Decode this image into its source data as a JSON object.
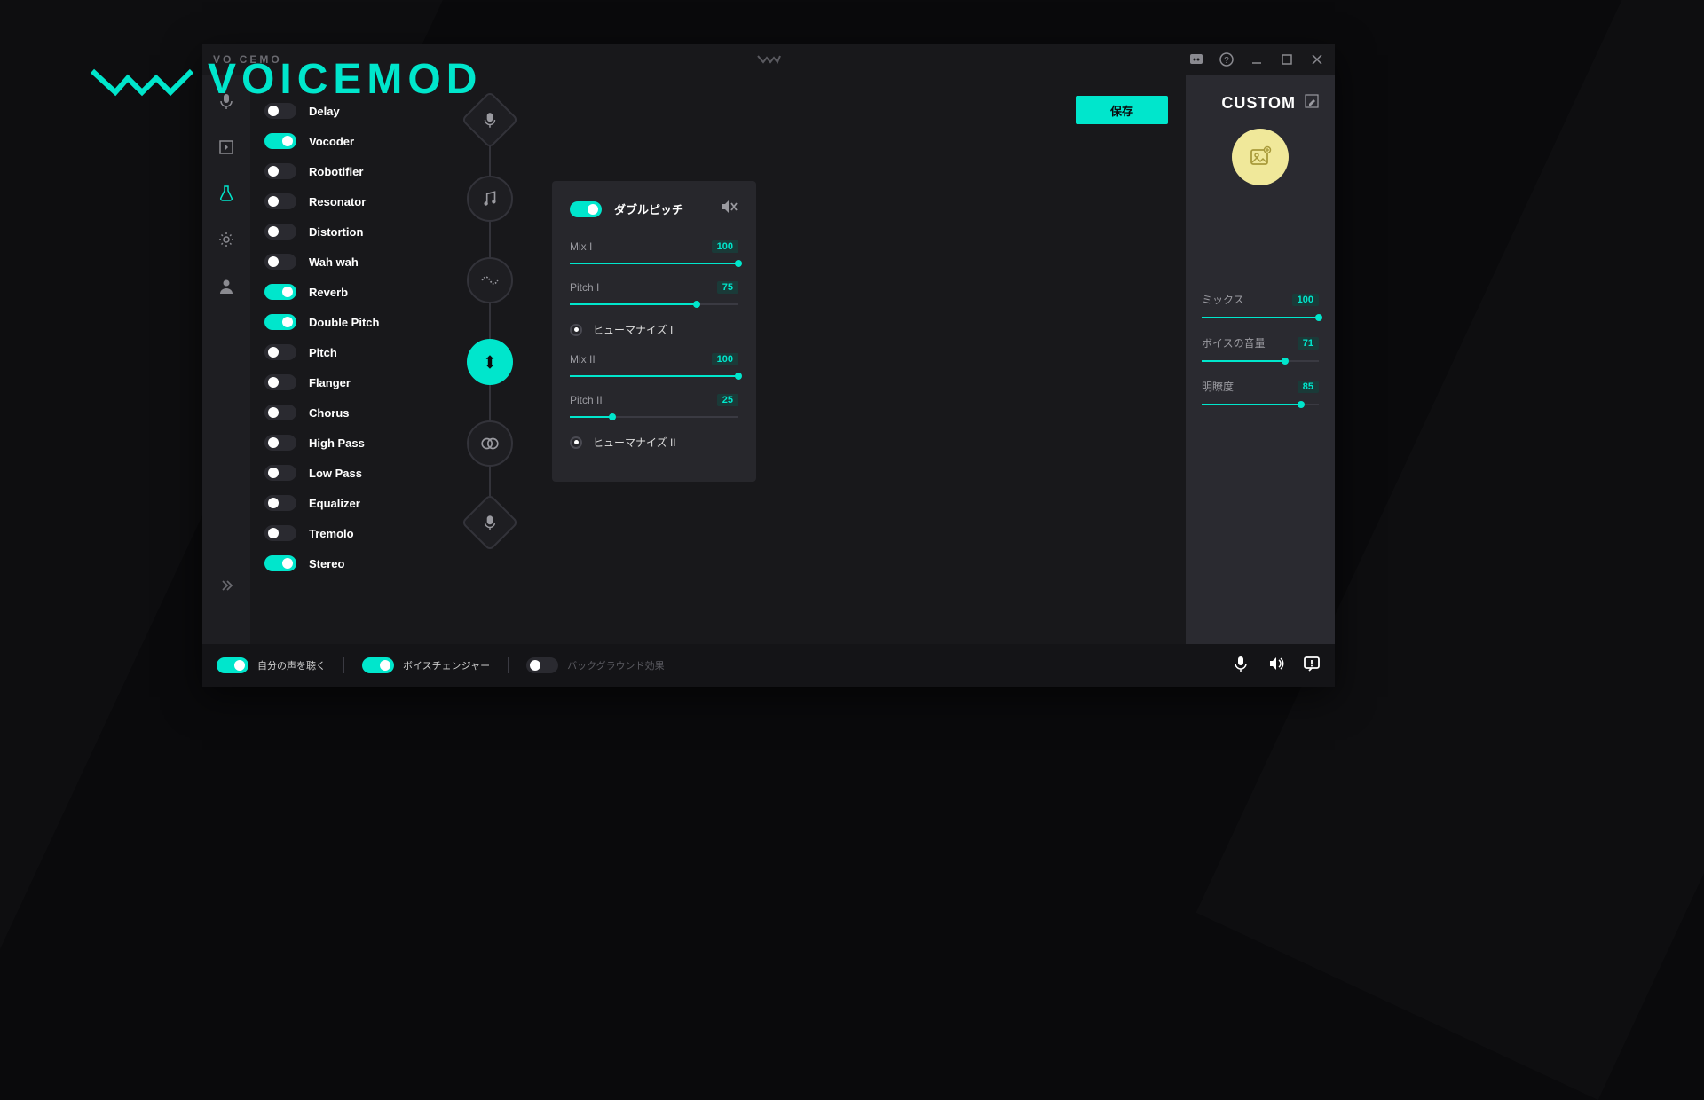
{
  "brand": {
    "text": "VOICEMOD"
  },
  "titlebar": {
    "left": "VO CEMO"
  },
  "nav": {
    "active_index": 2
  },
  "effects": [
    {
      "label": "Delay",
      "on": false
    },
    {
      "label": "Vocoder",
      "on": true
    },
    {
      "label": "Robotifier",
      "on": false
    },
    {
      "label": "Resonator",
      "on": false
    },
    {
      "label": "Distortion",
      "on": false
    },
    {
      "label": "Wah wah",
      "on": false
    },
    {
      "label": "Reverb",
      "on": true
    },
    {
      "label": "Double Pitch",
      "on": true
    },
    {
      "label": "Pitch",
      "on": false
    },
    {
      "label": "Flanger",
      "on": false
    },
    {
      "label": "Chorus",
      "on": false
    },
    {
      "label": "High Pass",
      "on": false
    },
    {
      "label": "Low Pass",
      "on": false
    },
    {
      "label": "Equalizer",
      "on": false
    },
    {
      "label": "Tremolo",
      "on": false
    },
    {
      "label": "Stereo",
      "on": true
    }
  ],
  "save_button": "保存",
  "effect_panel": {
    "title": "ダブルピッチ",
    "toggle_on": true,
    "params": [
      {
        "label": "Mix I",
        "value": 100,
        "pct": 100
      },
      {
        "label": "Pitch I",
        "value": 75,
        "pct": 75
      }
    ],
    "humanize1": {
      "label": "ヒューマナイズ I",
      "checked": true
    },
    "params2": [
      {
        "label": "Mix II",
        "value": 100,
        "pct": 100
      },
      {
        "label": "Pitch II",
        "value": 25,
        "pct": 25
      }
    ],
    "humanize2": {
      "label": "ヒューマナイズ II",
      "checked": true
    }
  },
  "right_panel": {
    "title": "CUSTOM",
    "sliders": [
      {
        "label": "ミックス",
        "value": 100,
        "pct": 100
      },
      {
        "label": "ボイスの音量",
        "value": 71,
        "pct": 71
      },
      {
        "label": "明瞭度",
        "value": 85,
        "pct": 85
      }
    ]
  },
  "bottom": {
    "hear_self": {
      "label": "自分の声を聴く",
      "on": true
    },
    "changer": {
      "label": "ボイスチェンジャー",
      "on": true
    },
    "background": {
      "label": "バックグラウンド効果",
      "on": false
    }
  }
}
